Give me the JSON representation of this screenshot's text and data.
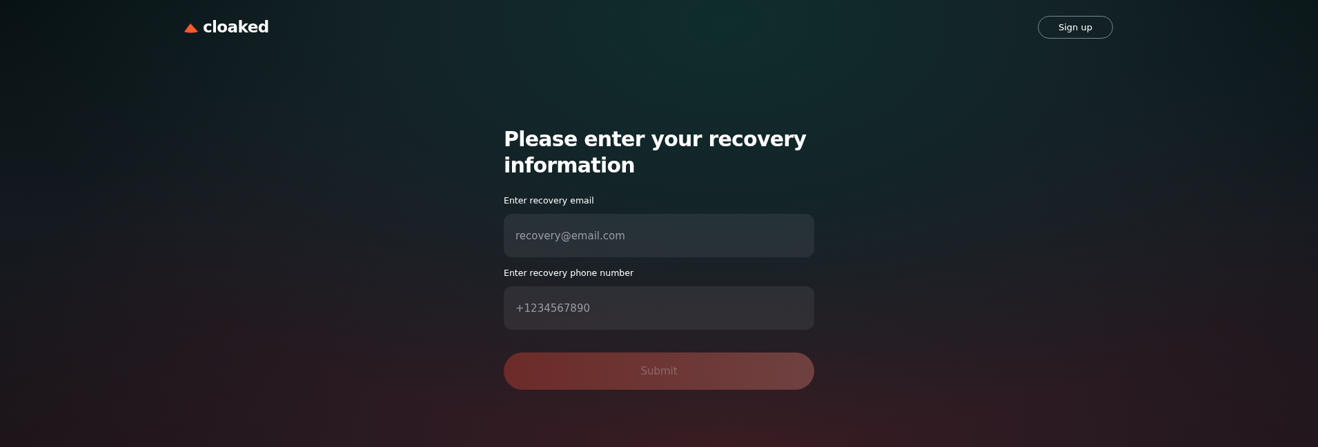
{
  "header": {
    "logo": "cloaked",
    "signup_button": "Sign up"
  },
  "form": {
    "title": "Please enter your recovery information",
    "fields": [
      {
        "label": "Enter recovery email",
        "placeholder": "recovery@email.com"
      },
      {
        "label": "Enter recovery phone number",
        "placeholder": "+1234567890"
      }
    ],
    "submit": {
      "label": "Submit",
      "disabled": true
    }
  }
}
